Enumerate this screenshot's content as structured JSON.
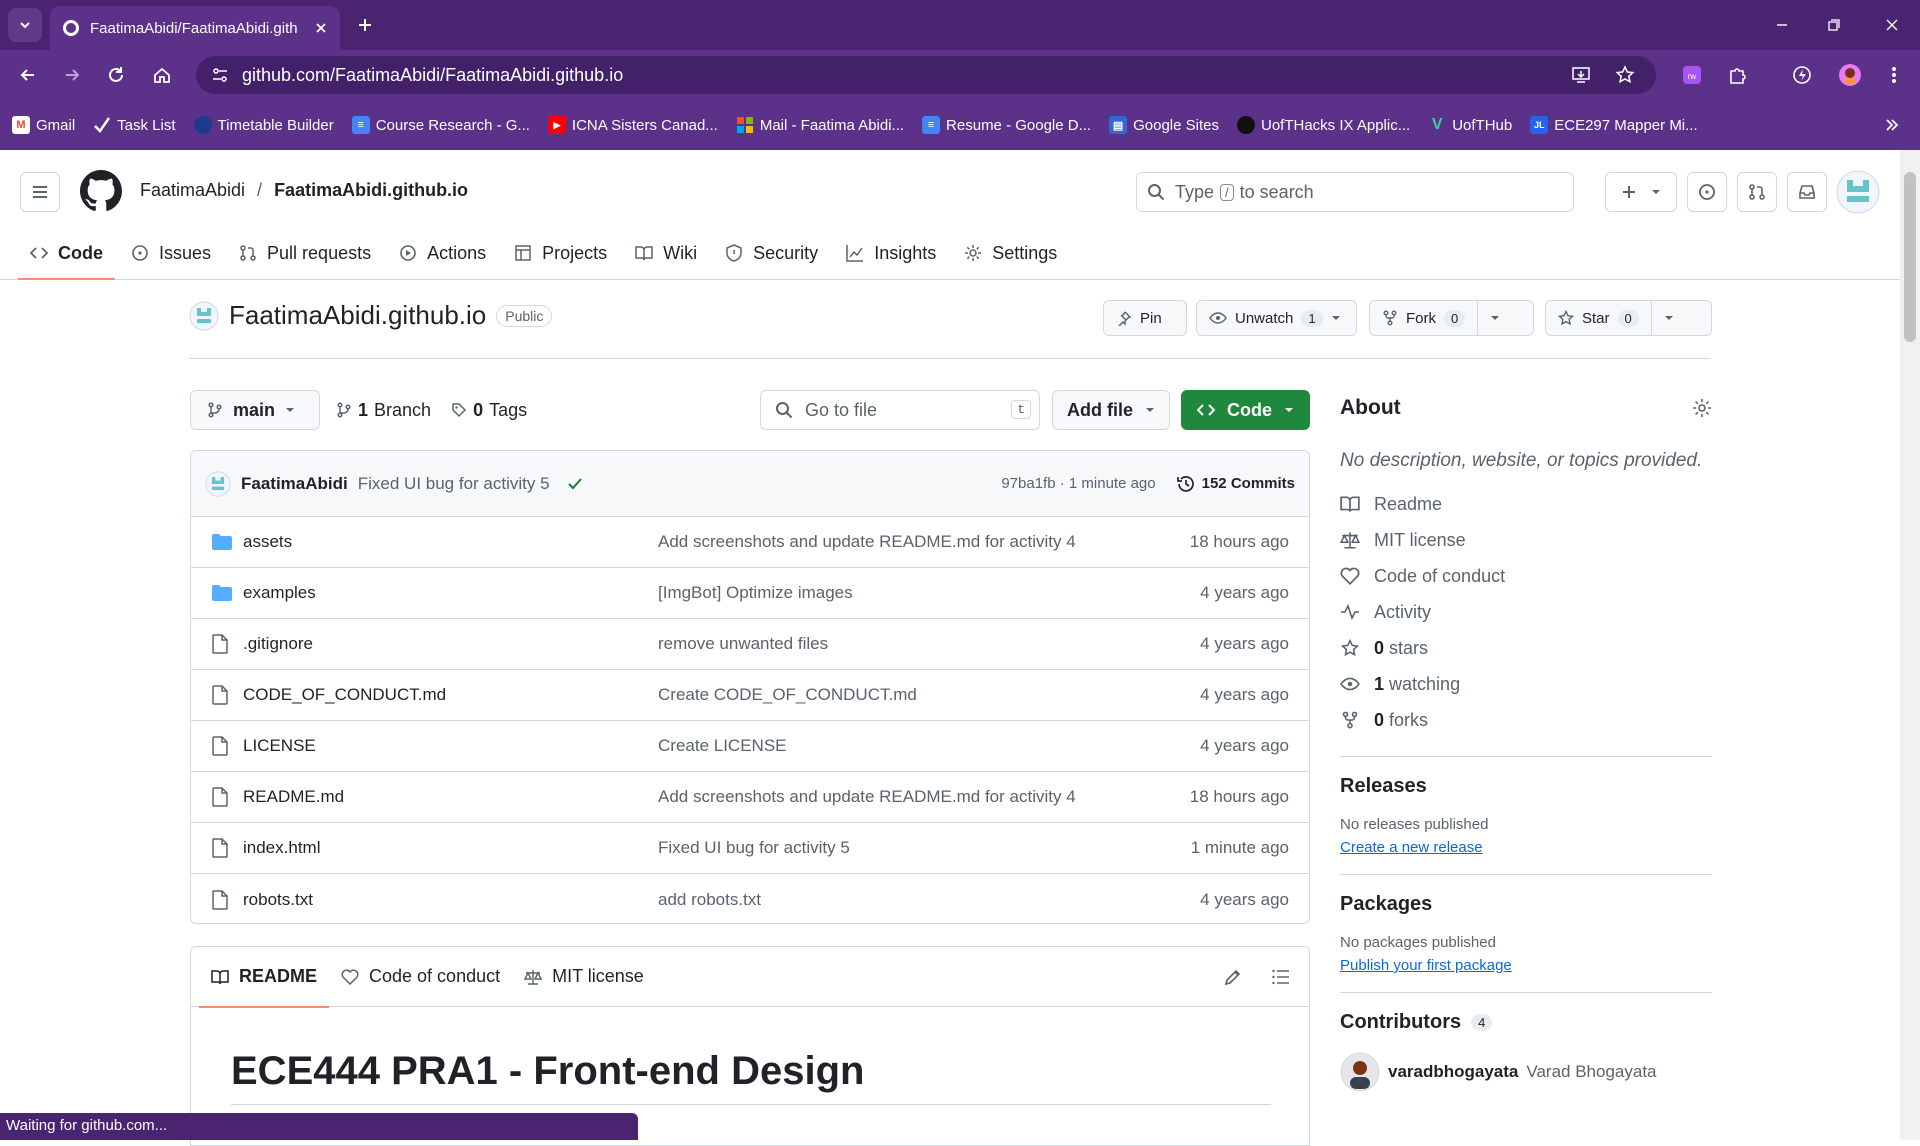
{
  "browser": {
    "tab_title": "FaatimaAbidi/FaatimaAbidi.gith",
    "url": "github.com/FaatimaAbidi/FaatimaAbidi.github.io",
    "bookmarks": [
      {
        "label": "Gmail",
        "icon": "gmail-icon",
        "color": "#ea4335"
      },
      {
        "label": "Task List",
        "icon": "check-icon",
        "color": "#ffffff"
      },
      {
        "label": "Timetable Builder",
        "icon": "timetable-icon",
        "color": "#1e3a8a"
      },
      {
        "label": "Course Research - G...",
        "icon": "google-docs-icon",
        "color": "#4285f4"
      },
      {
        "label": "ICNA Sisters Canad...",
        "icon": "youtube-icon",
        "color": "#ff0000"
      },
      {
        "label": "Mail - Faatima Abidi...",
        "icon": "microsoft-icon",
        "color": "#f25022"
      },
      {
        "label": "Resume - Google D...",
        "icon": "google-docs-icon",
        "color": "#4285f4"
      },
      {
        "label": "Google Sites",
        "icon": "google-sites-icon",
        "color": "#3367d6"
      },
      {
        "label": "UofTHacks IX Applic...",
        "icon": "circle-icon",
        "color": "#111111"
      },
      {
        "label": "UofTHub",
        "icon": "v-icon",
        "color": "#34d399"
      },
      {
        "label": "ECE297 Mapper Mi...",
        "icon": "jl-icon",
        "color": "#2563eb"
      }
    ]
  },
  "header": {
    "owner": "FaatimaAbidi",
    "separator": "/",
    "repo": "FaatimaAbidi.github.io",
    "search_prefix": "Type",
    "search_key": "/",
    "search_suffix": "to search"
  },
  "repo_nav": [
    {
      "label": "Code",
      "icon": "code-icon",
      "active": true
    },
    {
      "label": "Issues",
      "icon": "issue-icon"
    },
    {
      "label": "Pull requests",
      "icon": "pull-request-icon"
    },
    {
      "label": "Actions",
      "icon": "play-icon"
    },
    {
      "label": "Projects",
      "icon": "table-icon"
    },
    {
      "label": "Wiki",
      "icon": "book-icon"
    },
    {
      "label": "Security",
      "icon": "shield-icon"
    },
    {
      "label": "Insights",
      "icon": "graph-icon"
    },
    {
      "label": "Settings",
      "icon": "gear-icon"
    }
  ],
  "repo": {
    "name": "FaatimaAbidi.github.io",
    "visibility": "Public",
    "pin": "Pin",
    "unwatch": "Unwatch",
    "watch_count": "1",
    "fork": "Fork",
    "fork_count": "0",
    "star": "Star",
    "star_count": "0"
  },
  "filebar": {
    "branch": "main",
    "branch_count": "1",
    "branch_label": "Branch",
    "tag_count": "0",
    "tag_label": "Tags",
    "goto_placeholder": "Go to file",
    "goto_key": "t",
    "add_file": "Add file",
    "code": "Code"
  },
  "latest_commit": {
    "author": "FaatimaAbidi",
    "message": "Fixed UI bug for activity 5",
    "hash_time": "97ba1fb · 1 minute ago",
    "commits": "152 Commits"
  },
  "files": [
    {
      "name": "assets",
      "type": "dir",
      "message": "Add screenshots and update README.md for activity 4",
      "date": "18 hours ago"
    },
    {
      "name": "examples",
      "type": "dir",
      "message": "[ImgBot] Optimize images",
      "date": "4 years ago"
    },
    {
      "name": ".gitignore",
      "type": "file",
      "message": "remove unwanted files",
      "date": "4 years ago"
    },
    {
      "name": "CODE_OF_CONDUCT.md",
      "type": "file",
      "message": "Create CODE_OF_CONDUCT.md",
      "date": "4 years ago"
    },
    {
      "name": "LICENSE",
      "type": "file",
      "message": "Create LICENSE",
      "date": "4 years ago"
    },
    {
      "name": "README.md",
      "type": "file",
      "message": "Add screenshots and update README.md for activity 4",
      "date": "18 hours ago"
    },
    {
      "name": "index.html",
      "type": "file",
      "message": "Fixed UI bug for activity 5",
      "date": "1 minute ago"
    },
    {
      "name": "robots.txt",
      "type": "file",
      "message": "add robots.txt",
      "date": "4 years ago"
    }
  ],
  "readme": {
    "tabs": [
      "README",
      "Code of conduct",
      "MIT license"
    ],
    "heading": "ECE444 PRA1 - Front-end Design"
  },
  "about": {
    "title": "About",
    "description": "No description, website, or topics provided.",
    "readme": "Readme",
    "license": "MIT license",
    "conduct": "Code of conduct",
    "activity": "Activity",
    "stars_count": "0",
    "stars_label": "stars",
    "watching_count": "1",
    "watching_label": "watching",
    "forks_count": "0",
    "forks_label": "forks"
  },
  "releases": {
    "title": "Releases",
    "none": "No releases published",
    "link": "Create a new release"
  },
  "packages": {
    "title": "Packages",
    "none": "No packages published",
    "link": "Publish your first package"
  },
  "contributors": {
    "title": "Contributors",
    "count": "4",
    "first_login": "varadbhogayata",
    "first_name": "Varad Bhogayata"
  },
  "status_text": "Waiting for github.com..."
}
